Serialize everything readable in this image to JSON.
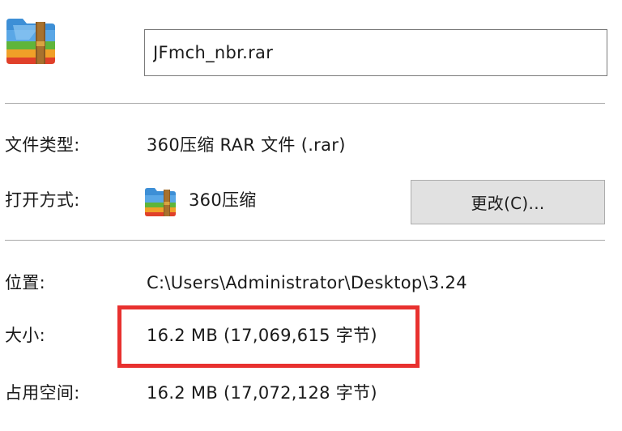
{
  "file": {
    "icon": "winrar-archive-icon",
    "name": "JFmch_nbr.rar"
  },
  "file_type": {
    "label": "文件类型:",
    "value": "360压缩 RAR 文件 (.rar)"
  },
  "opens_with": {
    "label": "打开方式:",
    "icon": "winrar-archive-icon",
    "value": "360压缩",
    "change_button": "更改(C)..."
  },
  "location": {
    "label": "位置:",
    "value": "C:\\Users\\Administrator\\Desktop\\3.24"
  },
  "size": {
    "label": "大小:",
    "value": "16.2 MB (17,069,615 字节)"
  },
  "size_on_disk": {
    "label": "占用空间:",
    "value": "16.2 MB (17,072,128 字节)"
  },
  "colors": {
    "highlight": "#e8312f",
    "button_bg": "#e1e1e1",
    "divider": "#a8a8a8"
  }
}
